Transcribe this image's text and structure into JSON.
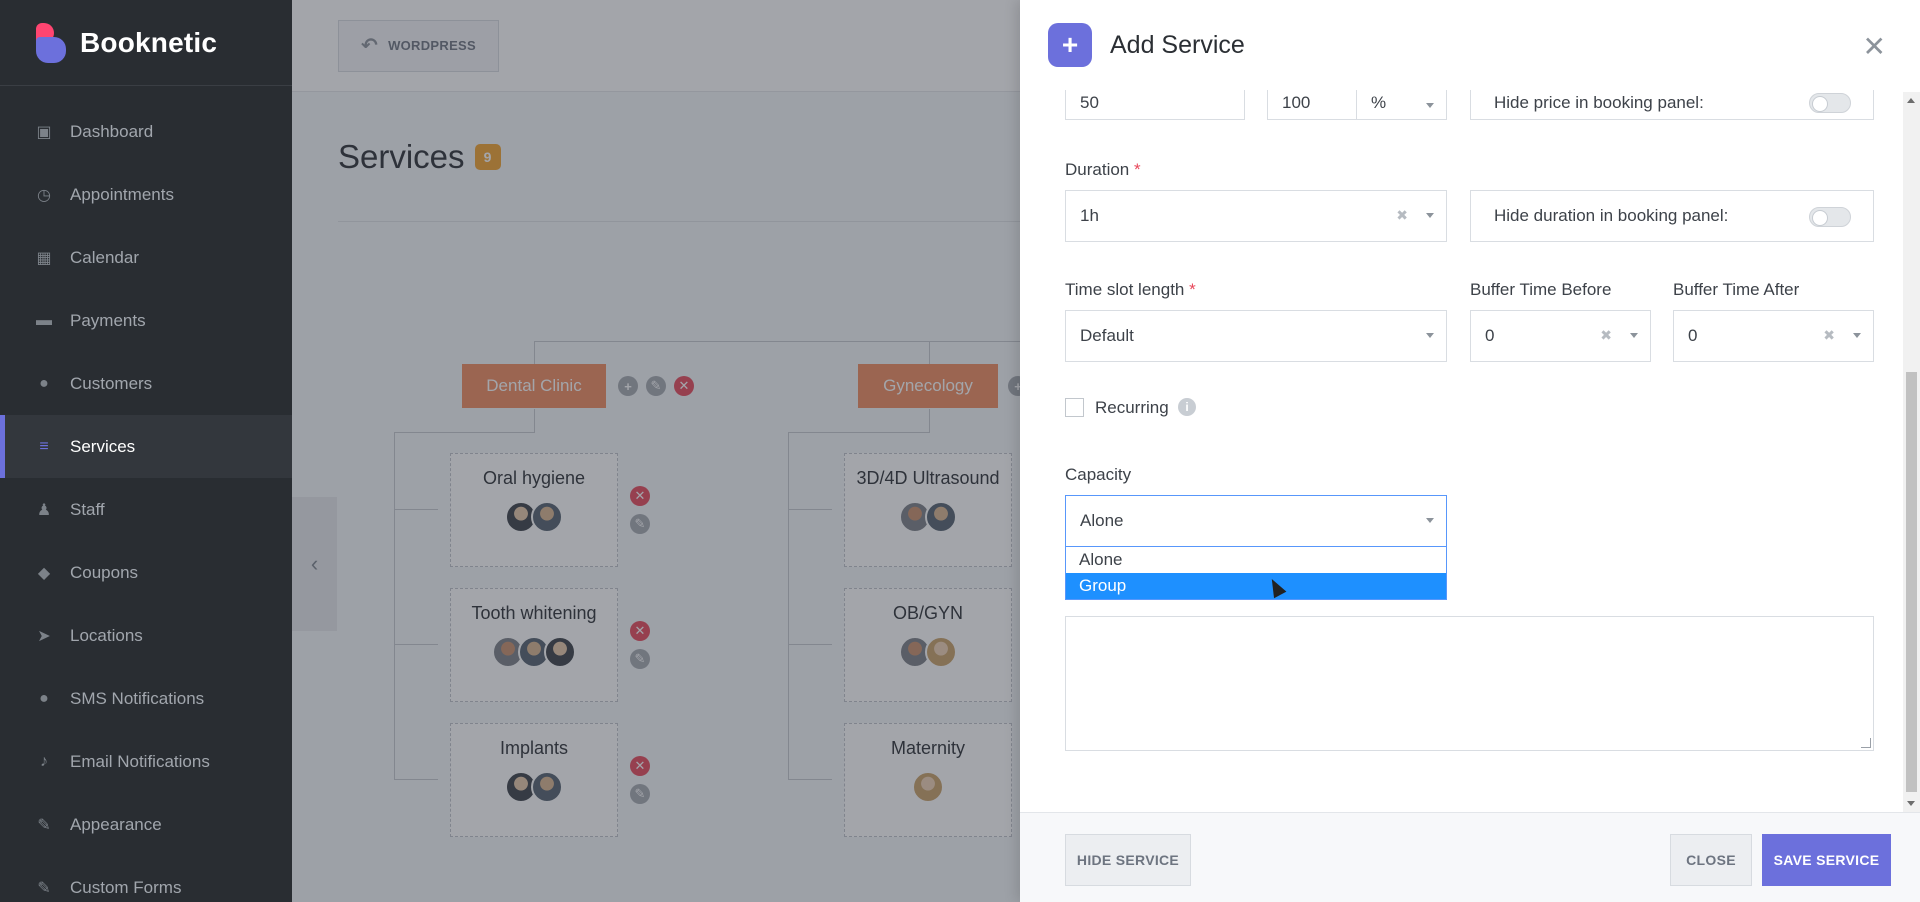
{
  "brand": {
    "name": "Booknetic"
  },
  "sidebar": {
    "items": [
      {
        "label": "Dashboard",
        "icon": "cube-icon",
        "glyph": "▣",
        "active": false
      },
      {
        "label": "Appointments",
        "icon": "clock-icon",
        "glyph": "◷",
        "active": false
      },
      {
        "label": "Calendar",
        "icon": "calendar-icon",
        "glyph": "▦",
        "active": false
      },
      {
        "label": "Payments",
        "icon": "wallet-icon",
        "glyph": "▬",
        "active": false
      },
      {
        "label": "Customers",
        "icon": "users-icon",
        "glyph": "●",
        "active": false
      },
      {
        "label": "Services",
        "icon": "list-icon",
        "glyph": "≡",
        "active": true
      },
      {
        "label": "Staff",
        "icon": "user-icon",
        "glyph": "♟",
        "active": false
      },
      {
        "label": "Coupons",
        "icon": "tag-icon",
        "glyph": "◆",
        "active": false
      },
      {
        "label": "Locations",
        "icon": "location-arrow-icon",
        "glyph": "➤",
        "active": false
      },
      {
        "label": "SMS Notifications",
        "icon": "chat-icon",
        "glyph": "●",
        "active": false
      },
      {
        "label": "Email Notifications",
        "icon": "bell-icon",
        "glyph": "♪",
        "active": false
      },
      {
        "label": "Appearance",
        "icon": "brush-icon",
        "glyph": "✎",
        "active": false
      },
      {
        "label": "Custom Forms",
        "icon": "form-icon",
        "glyph": "✎",
        "active": false
      }
    ]
  },
  "topbar": {
    "wordpress_label": "WORDPRESS"
  },
  "page": {
    "title": "Services",
    "count": "9"
  },
  "tree": {
    "categories": [
      {
        "name": "Dental Clinic"
      },
      {
        "name": "Gynecology"
      }
    ],
    "services": [
      {
        "name": "Oral hygiene"
      },
      {
        "name": "Tooth whitening"
      },
      {
        "name": "Implants"
      },
      {
        "name": "3D/4D Ultrasound"
      },
      {
        "name": "OB/GYN"
      },
      {
        "name": "Maternity"
      }
    ]
  },
  "panel": {
    "title": "Add Service",
    "price_value": "50",
    "deposit_value": "100",
    "deposit_type": "%",
    "hide_price_label": "Hide price in booking panel:",
    "duration_label": "Duration",
    "duration_value": "1h",
    "hide_duration_label": "Hide duration in booking panel:",
    "timeslot_label": "Time slot length",
    "timeslot_value": "Default",
    "buffer_before_label": "Buffer Time Before",
    "buffer_before_value": "0",
    "buffer_after_label": "Buffer Time After",
    "buffer_after_value": "0",
    "recurring_label": "Recurring",
    "capacity_label": "Capacity",
    "capacity_value": "Alone",
    "capacity_options": [
      "Alone",
      "Group"
    ],
    "required_mark": "*"
  },
  "footer": {
    "hide_label": "HIDE SERVICE",
    "close_label": "CLOSE",
    "save_label": "SAVE SERVICE"
  },
  "colors": {
    "accent": "#6c70dc",
    "category": "#f08a5d",
    "danger": "#e8475a",
    "highlight": "#1e90ff"
  }
}
